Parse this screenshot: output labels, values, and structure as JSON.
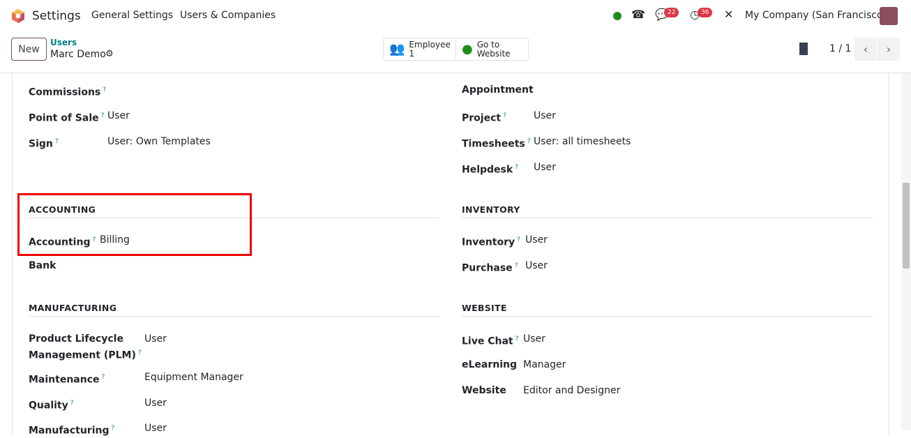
{
  "navbar": {
    "app": "Settings",
    "menus": [
      "General Settings",
      "Users & Companies"
    ],
    "messages_count": "22",
    "activities_count": "36",
    "company": "My Company (San Francisco)"
  },
  "control": {
    "new_label": "New",
    "breadcrumb_parent": "Users",
    "record": "Marc Demo",
    "employee_label": "Employee",
    "employee_count": "1",
    "website_label": "Go to",
    "website_label2": "Website",
    "pager": "1 / 1"
  },
  "left_top": [
    {
      "label": "Commissions",
      "help": "?",
      "value": ""
    },
    {
      "label": "Point of Sale",
      "help": "?",
      "value": "User"
    },
    {
      "label": "Sign",
      "help": "?",
      "value": "User: Own Templates"
    }
  ],
  "right_top": [
    {
      "label": "Appointment",
      "help": "",
      "value": ""
    },
    {
      "label": "Project",
      "help": "?",
      "value": "User"
    },
    {
      "label": "Timesheets",
      "help": "?",
      "value": "User: all timesheets"
    },
    {
      "label": "Helpdesk",
      "help": "?",
      "value": "User"
    }
  ],
  "accounting": {
    "title": "ACCOUNTING",
    "rows": [
      {
        "label": "Accounting",
        "help": "?",
        "value": "Billing"
      },
      {
        "label": "Bank",
        "help": "",
        "value": ""
      }
    ]
  },
  "inventory": {
    "title": "INVENTORY",
    "rows": [
      {
        "label": "Inventory",
        "help": "?",
        "value": "User"
      },
      {
        "label": "Purchase",
        "help": "?",
        "value": "User"
      }
    ]
  },
  "manufacturing": {
    "title": "MANUFACTURING",
    "rows": [
      {
        "label": "Product Lifecycle",
        "label2": "Management (PLM)",
        "help": "?",
        "value": "User"
      },
      {
        "label": "Maintenance",
        "help": "?",
        "value": "Equipment Manager"
      },
      {
        "label": "Quality",
        "help": "?",
        "value": "User"
      },
      {
        "label": "Manufacturing",
        "help": "?",
        "value": "User"
      }
    ]
  },
  "website": {
    "title": "WEBSITE",
    "rows": [
      {
        "label": "Live Chat",
        "help": "?",
        "value": "User"
      },
      {
        "label": "eLearning",
        "help": "",
        "value": "Manager"
      },
      {
        "label": "Website",
        "help": "",
        "value": "Editor and Designer"
      }
    ]
  },
  "colors": {
    "brand": "#714b67",
    "link": "#017e84",
    "badge": "#dc3545",
    "highlight": "#ee0000",
    "online": "#1a8f1a"
  }
}
